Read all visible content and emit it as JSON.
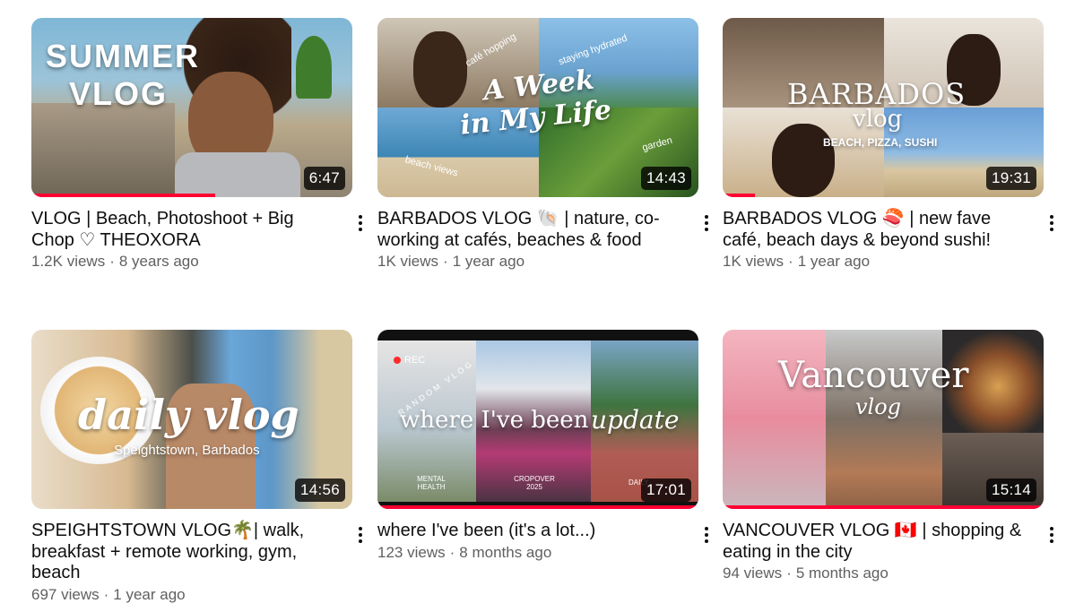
{
  "videos": [
    {
      "duration": "6:47",
      "progress": 0.57,
      "title": "VLOG | Beach, Photoshoot + Big Chop ♡ THEOXORA",
      "views": "1.2K views",
      "age": "8 years ago",
      "thumb_text": [
        "SUMMER",
        "VLOG"
      ]
    },
    {
      "duration": "14:43",
      "progress": 0.0,
      "title": "BARBADOS VLOG 🐚 | nature, co-working at cafés, beaches & food",
      "views": "1K views",
      "age": "1 year ago",
      "thumb_text": [
        "A Week",
        "in My Life",
        "café hopping",
        "staying hydrated",
        "beach views",
        "garden"
      ]
    },
    {
      "duration": "19:31",
      "progress": 0.1,
      "title": "BARBADOS VLOG 🍣 | new fave café, beach days & beyond sushi!",
      "views": "1K views",
      "age": "1 year ago",
      "thumb_text": [
        "BARBADOS",
        "vlog",
        "BEACH, PIZZA, SUSHI"
      ]
    },
    {
      "duration": "14:56",
      "progress": 0.0,
      "title": "SPEIGHTSTOWN VLOG🌴| walk, breakfast + remote working, gym, beach",
      "views": "697 views",
      "age": "1 year ago",
      "thumb_text": [
        "daily vlog",
        "Speightstown, Barbados"
      ]
    },
    {
      "duration": "17:01",
      "progress": 1.0,
      "title": "where I've been (it's a lot...)",
      "views": "123 views",
      "age": "8 months ago",
      "thumb_text": [
        "where I've been",
        "update",
        "REC",
        "RANDOM VLOG",
        "MENTAL HEALTH",
        "CROPOVER 2025",
        "DAILY"
      ]
    },
    {
      "duration": "15:14",
      "progress": 1.0,
      "title": "VANCOUVER VLOG 🇨🇦 | shopping & eating in the city",
      "views": "94 views",
      "age": "5 months ago",
      "thumb_text": [
        "Vancouver",
        "vlog"
      ]
    }
  ]
}
